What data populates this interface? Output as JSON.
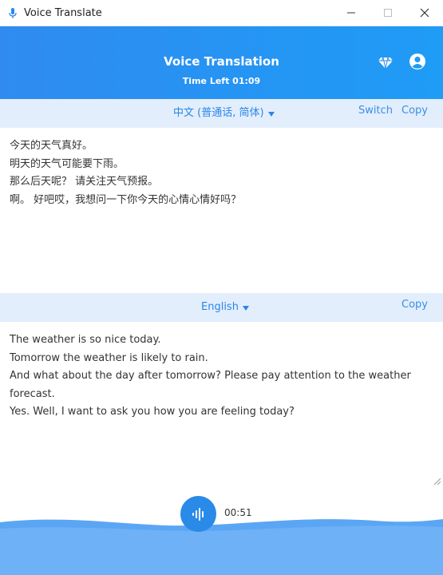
{
  "window": {
    "title": "Voice Translate",
    "controls": [
      "minimize",
      "maximize",
      "close"
    ]
  },
  "header": {
    "title": "Voice Translation",
    "time_left": "Time Left 01:09",
    "icons": [
      "diamond-icon",
      "account-icon"
    ]
  },
  "source": {
    "language": "中文 (普通话, 简体)",
    "switch_label": "Switch",
    "copy_label": "Copy",
    "lines": [
      "今天的天气真好。",
      "明天的天气可能要下雨。",
      "那么后天呢？ 请关注天气预报。",
      "啊。 好吧哎，我想问一下你今天的心情心情好吗？"
    ]
  },
  "target": {
    "language": "English",
    "copy_label": "Copy",
    "lines": [
      "The weather is so nice today.",
      "Tomorrow the weather is likely to rain.",
      "And what about the day after tomorrow? Please pay attention to the weather forecast.",
      "Yes. Well, I want to ask you how you are feeling today?"
    ]
  },
  "recorder": {
    "elapsed": "00:51",
    "icon": "voice-wave-icon"
  },
  "colors": {
    "accent": "#2a86e8",
    "header_bg": "#2f8bf0",
    "lang_bar_bg": "#e2eefc",
    "wave": "#5aa6f4"
  }
}
